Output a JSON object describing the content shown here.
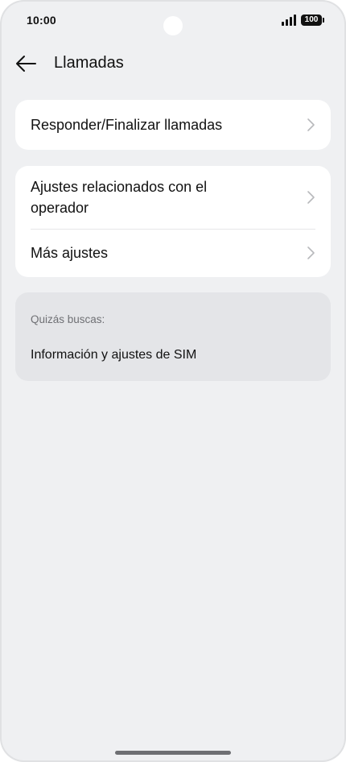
{
  "status_bar": {
    "time": "10:00",
    "battery": "100",
    "icons": [
      "signal-icon",
      "battery-icon"
    ]
  },
  "header": {
    "back_icon": "arrow-left-icon",
    "title": "Llamadas"
  },
  "sections": [
    {
      "items": [
        {
          "label": "Responder/Finalizar llamadas",
          "icon": "chevron-right-icon"
        }
      ]
    },
    {
      "items": [
        {
          "label": "Ajustes relacionados con el operador",
          "icon": "chevron-right-icon"
        },
        {
          "label": "Más ajustes",
          "icon": "chevron-right-icon"
        }
      ]
    }
  ],
  "suggestions": {
    "caption": "Quizás buscas:",
    "items": [
      {
        "label": "Información y ajustes de SIM"
      }
    ]
  },
  "colors": {
    "background": "#eff0f2",
    "card": "#ffffff",
    "suggestion_card": "#e4e5e8",
    "text_primary": "#111111",
    "text_secondary": "#6f7074",
    "chevron": "#b8b9bc"
  }
}
